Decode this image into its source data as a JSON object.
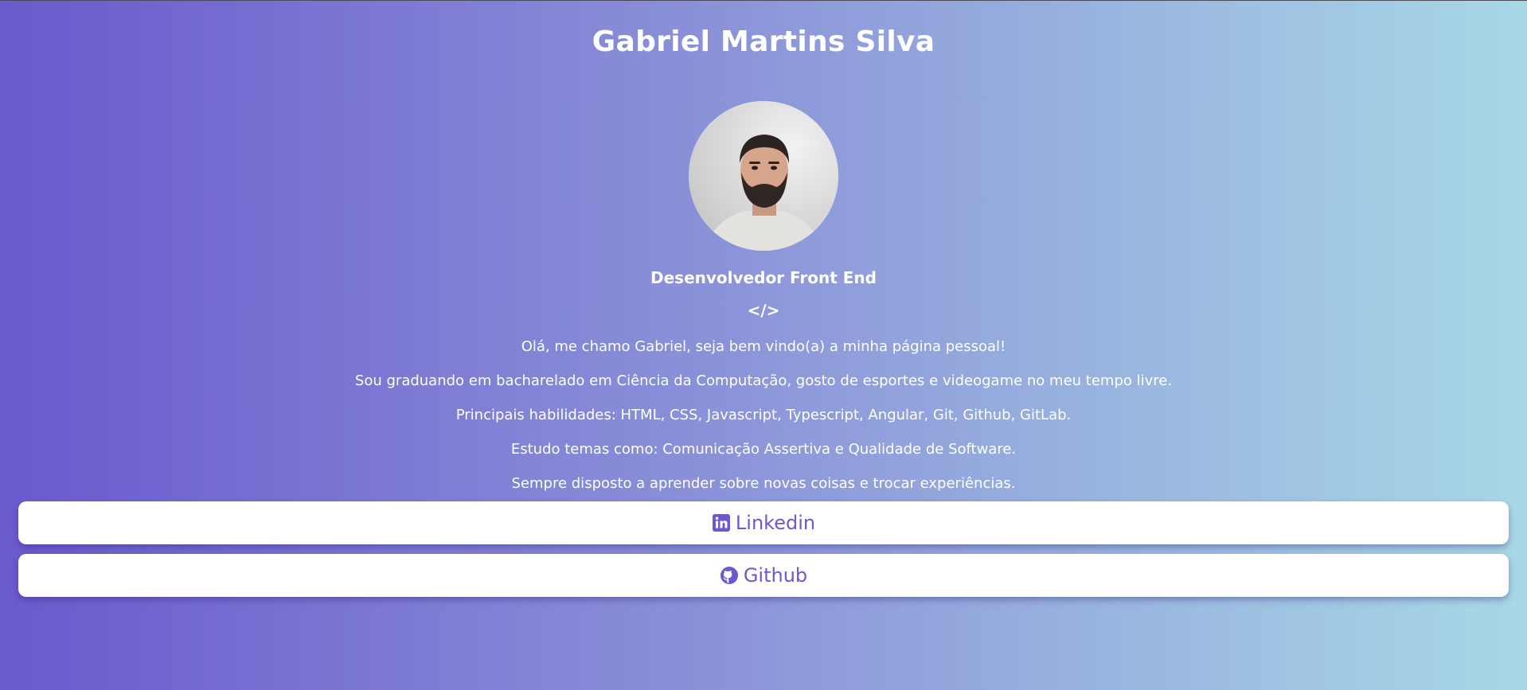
{
  "profile": {
    "name": "Gabriel Martins Silva",
    "role": "Desenvolvedor Front End",
    "code_glyph": "</>"
  },
  "bio": {
    "lines": [
      "Olá, me chamo Gabriel, seja bem vindo(a) a minha página pessoal!",
      "Sou graduando em bacharelado em Ciência da Computação, gosto de esportes e videogame no meu tempo livre.",
      "Principais habilidades: HTML, CSS, Javascript, Typescript, Angular, Git, Github, GitLab.",
      "Estudo temas como: Comunicação Assertiva e Qualidade de Software.",
      "Sempre disposto a aprender sobre novas coisas e trocar experiências."
    ]
  },
  "links": [
    {
      "label": "Linkedin",
      "icon": "linkedin-icon"
    },
    {
      "label": "Github",
      "icon": "github-icon"
    }
  ],
  "colors": {
    "gradient_start": "#6a5acd",
    "gradient_end": "#a8d8e6",
    "button_bg": "#ffffff",
    "button_text": "#6a5acd",
    "text": "#ffffff"
  }
}
